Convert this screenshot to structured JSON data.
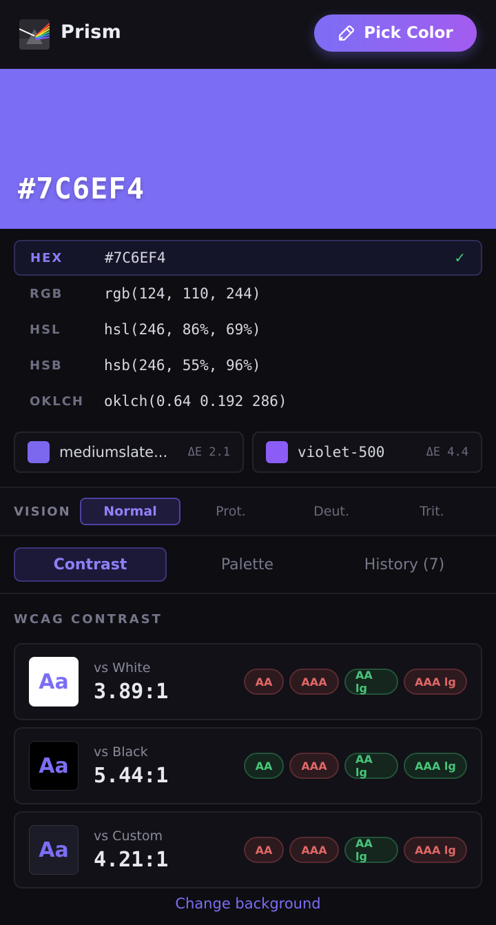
{
  "app": {
    "name": "Prism",
    "pick_button_label": "Pick Color",
    "icons": {
      "logo": "prism-logo",
      "pick": "eyedropper-icon"
    },
    "accent_gradient": [
      "#7c6ef4",
      "#a35cf0"
    ]
  },
  "current": {
    "hex": "#7C6EF4",
    "swatch_color": "#7c6ef4"
  },
  "formats": [
    {
      "label": "HEX",
      "value": "#7C6EF4",
      "active": true,
      "check": "✓"
    },
    {
      "label": "RGB",
      "value": "rgb(124, 110, 244)"
    },
    {
      "label": "HSL",
      "value": "hsl(246, 86%, 69%)"
    },
    {
      "label": "HSB",
      "value": "hsb(246, 55%, 96%)"
    },
    {
      "label": "OKLCH",
      "value": "oklch(0.64 0.192 286)"
    }
  ],
  "matches": [
    {
      "name": "mediumslate...",
      "delta": "ΔE 2.1",
      "color": "#7b68ee"
    },
    {
      "name": "violet-500",
      "delta": "ΔE 4.4",
      "color": "#8b5cf6"
    }
  ],
  "vision": {
    "label": "VISION",
    "options": [
      "Normal",
      "Prot.",
      "Deut.",
      "Trit."
    ],
    "selected": "Normal"
  },
  "tabs": [
    "Contrast",
    "Palette",
    "History (7)"
  ],
  "active_tab": "Contrast",
  "contrast": {
    "title": "WCAG CONTRAST",
    "cards": [
      {
        "label": "vs White",
        "ratio": "3.89:1",
        "sample": "Aa",
        "badges": [
          {
            "text": "AA",
            "pass": false
          },
          {
            "text": "AAA",
            "pass": false
          },
          {
            "text": "AA lg",
            "pass": true
          },
          {
            "text": "AAA lg",
            "pass": false
          }
        ]
      },
      {
        "label": "vs Black",
        "ratio": "5.44:1",
        "sample": "Aa",
        "badges": [
          {
            "text": "AA",
            "pass": true
          },
          {
            "text": "AAA",
            "pass": false
          },
          {
            "text": "AA lg",
            "pass": true
          },
          {
            "text": "AAA lg",
            "pass": true
          }
        ]
      },
      {
        "label": "vs Custom",
        "ratio": "4.21:1",
        "sample": "Aa",
        "badges": [
          {
            "text": "AA",
            "pass": false
          },
          {
            "text": "AAA",
            "pass": false
          },
          {
            "text": "AA lg",
            "pass": true
          },
          {
            "text": "AAA lg",
            "pass": false
          }
        ]
      }
    ],
    "change_bg_label": "Change background"
  }
}
